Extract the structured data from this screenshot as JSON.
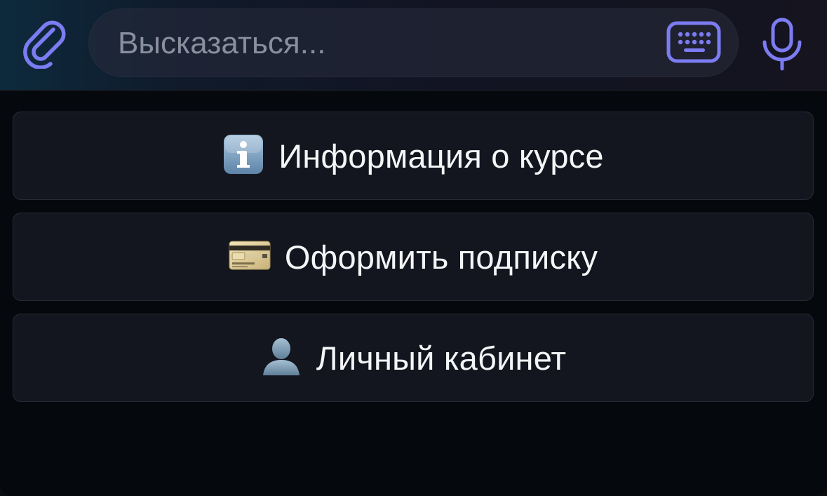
{
  "composer": {
    "placeholder": "Высказаться...",
    "colors": {
      "accent": "#7c7cf2"
    }
  },
  "icons": {
    "attach": "paperclip-icon",
    "keyboard": "keyboard-icon",
    "mic": "microphone-icon"
  },
  "buttons": [
    {
      "label": "Информация о курсе",
      "icon": "information-icon"
    },
    {
      "label": "Оформить подписку",
      "icon": "credit-card-icon"
    },
    {
      "label": "Личный кабинет",
      "icon": "bust-silhouette-icon"
    }
  ]
}
